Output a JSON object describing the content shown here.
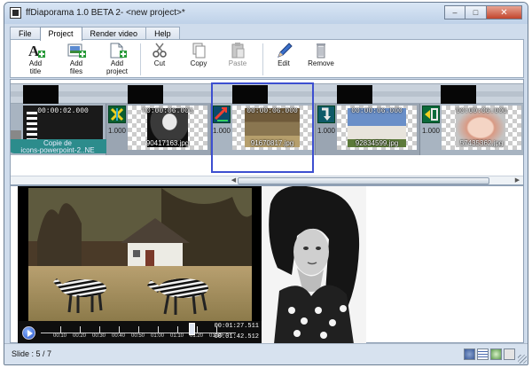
{
  "window": {
    "title": "ffDiaporama 1.0 BETA 2- <new project>*",
    "controls": [
      "minimize",
      "maximize",
      "close"
    ]
  },
  "menu_tabs": [
    {
      "label": "File",
      "active": false
    },
    {
      "label": "Project",
      "active": true
    },
    {
      "label": "Render video",
      "active": false
    },
    {
      "label": "Help",
      "active": false
    }
  ],
  "toolbar": {
    "add_title": "Add\ntitle",
    "add_files": "Add\nfiles",
    "add_project": "Add\nproject",
    "cut": "Cut",
    "copy": "Copy",
    "paste": "Paste",
    "edit": "Edit",
    "remove": "Remove"
  },
  "timeline": {
    "slides": [
      {
        "duration": "00:00:02.000",
        "filename": "",
        "transition_value": "",
        "icon": "title-slide-icon"
      },
      {
        "duration": "00:00:06.000",
        "filename": "90417163.jpg",
        "transition_value": "1.000",
        "icon": "transition-icon"
      },
      {
        "duration": "00:00:06.000",
        "filename": "91670817.jpg",
        "transition_value": "1.000",
        "icon": "transition-icon"
      },
      {
        "duration": "00:00:06.000",
        "filename": "92834599.jpg",
        "transition_value": "1.000",
        "icon": "transition-icon"
      },
      {
        "duration": "00:00:06.000",
        "filename": "57435362.jpg",
        "transition_value": "1.000",
        "icon": "transition-icon"
      }
    ],
    "caption": "Copie de\nicons-powerpoint-2..NE",
    "selected_index": 2
  },
  "player": {
    "position": "00:01:27.511",
    "total": "00:01:42.512",
    "tick_labels": [
      "00:10",
      "00:20",
      "00:30",
      "00:40",
      "00:50",
      "01:00",
      "01:10",
      "01:20",
      "01:30"
    ],
    "progress": 0.854
  },
  "status": {
    "slide_text": "Slide : 5 / 7"
  },
  "colors": {
    "selection": "#3d4fd0",
    "caption_bar": "#2c8c8c",
    "ribbon_bg": "#ffffff",
    "frame_bg": "#cfdcec"
  }
}
